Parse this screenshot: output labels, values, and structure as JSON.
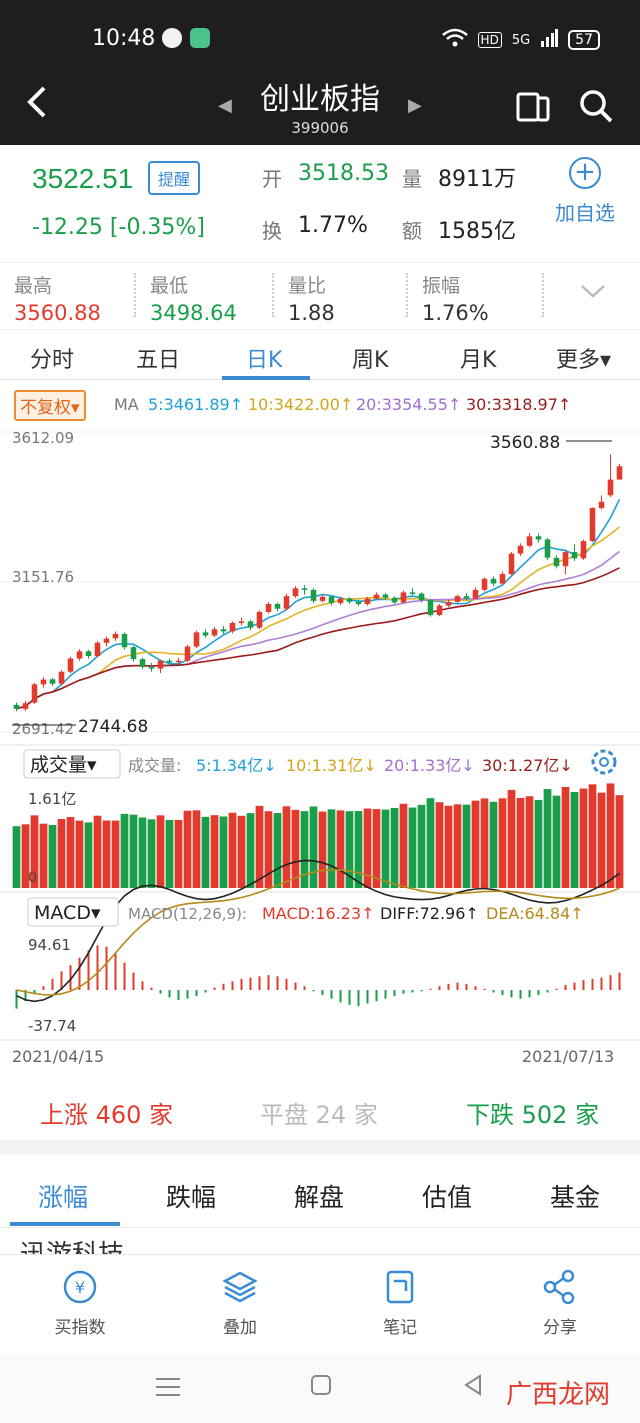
{
  "status": {
    "time": "10:48",
    "battery": "57",
    "signal": "5G",
    "hd": "HD"
  },
  "header": {
    "title": "创业板指",
    "code": "399006"
  },
  "quote": {
    "price": "3522.51",
    "remind_label": "提醒",
    "change": "-12.25",
    "change_pct": "[-0.35%]",
    "open_label": "开",
    "open": "3518.53",
    "volume_label": "量",
    "volume": "8911万",
    "turnover_label": "换",
    "turnover": "1.77%",
    "amount_label": "额",
    "amount": "1585亿",
    "add_label": "加自选"
  },
  "stats": [
    {
      "label": "最高",
      "value": "3560.88"
    },
    {
      "label": "最低",
      "value": "3498.64"
    },
    {
      "label": "量比",
      "value": "1.88"
    },
    {
      "label": "振幅",
      "value": "1.76%"
    }
  ],
  "tabs": [
    "分时",
    "五日",
    "日K",
    "周K",
    "月K",
    "更多▾"
  ],
  "ma_bar": {
    "fq_label": "不复权▾",
    "prefix": "MA",
    "ma5": "5:3461.89↑",
    "ma10": "10:3422.00↑",
    "ma20": "20:3354.55↑",
    "ma30": "30:3318.97↑"
  },
  "vol_bar": {
    "label": "成交量▾",
    "prefix": "成交量:",
    "v5": "5:1.34亿↓",
    "v10": "10:1.31亿↓",
    "v20": "20:1.33亿↓",
    "v30": "30:1.27亿↓"
  },
  "macd_bar": {
    "label": "MACD▾",
    "params": "MACD(12,26,9):",
    "macd": "MACD:16.23↑",
    "diff": "DIFF:72.96↑",
    "dea": "DEA:64.84↑"
  },
  "colors": {
    "up": "#e23b2e",
    "down": "#1a9e4a",
    "accent": "#3a8bd1",
    "ma5": "#1ea1d6",
    "ma10": "#e6b422",
    "ma20": "#b07fd6",
    "ma30": "#9b1b1b"
  },
  "chart_data": {
    "type": "candlestick",
    "price_axis": {
      "top_label": "3612.09",
      "mid_label": "3151.76",
      "bottom_label": "2691.42",
      "ylim": [
        2691.42,
        3612.09
      ]
    },
    "max_marker": "3560.88",
    "min_marker": "2744.68",
    "vol_axis": {
      "top_label": "1.61亿",
      "bottom_label": "0"
    },
    "macd_axis": {
      "top_label": "94.61",
      "bottom_label": "-37.74"
    },
    "x_start": "2021/04/15",
    "x_end": "2021/07/13",
    "candles": [
      [
        2765,
        2752,
        2772,
        2744.68
      ],
      [
        2752,
        2770,
        2778,
        2745
      ],
      [
        2772,
        2830,
        2835,
        2768
      ],
      [
        2830,
        2845,
        2852,
        2820
      ],
      [
        2846,
        2832,
        2850,
        2825
      ],
      [
        2832,
        2870,
        2875,
        2828
      ],
      [
        2870,
        2912,
        2918,
        2865
      ],
      [
        2912,
        2935,
        2942,
        2905
      ],
      [
        2935,
        2920,
        2940,
        2912
      ],
      [
        2920,
        2962,
        2968,
        2915
      ],
      [
        2962,
        2975,
        2982,
        2950
      ],
      [
        2976,
        2990,
        2998,
        2968
      ],
      [
        2990,
        2948,
        2995,
        2940
      ],
      [
        2948,
        2910,
        2952,
        2902
      ],
      [
        2910,
        2885,
        2915,
        2878
      ],
      [
        2885,
        2880,
        2898,
        2870
      ],
      [
        2880,
        2905,
        2908,
        2866
      ],
      [
        2905,
        2900,
        2912,
        2890
      ],
      [
        2900,
        2905,
        2915,
        2895
      ],
      [
        2905,
        2950,
        2955,
        2900
      ],
      [
        2950,
        2995,
        3000,
        2945
      ],
      [
        2995,
        2985,
        3005,
        2978
      ],
      [
        2985,
        3005,
        3012,
        2980
      ],
      [
        3005,
        2998,
        3015,
        2990
      ],
      [
        2998,
        3025,
        3030,
        2992
      ],
      [
        3025,
        3030,
        3042,
        3018
      ],
      [
        3030,
        3010,
        3035,
        3002
      ],
      [
        3010,
        3060,
        3065,
        3005
      ],
      [
        3060,
        3085,
        3092,
        3055
      ],
      [
        3085,
        3070,
        3090,
        3062
      ],
      [
        3070,
        3110,
        3118,
        3065
      ],
      [
        3110,
        3135,
        3142,
        3105
      ],
      [
        3135,
        3130,
        3145,
        3115
      ],
      [
        3130,
        3095,
        3135,
        3088
      ],
      [
        3095,
        3108,
        3115,
        3090
      ],
      [
        3108,
        3088,
        3112,
        3080
      ],
      [
        3088,
        3102,
        3108,
        3082
      ],
      [
        3102,
        3092,
        3106,
        3085
      ],
      [
        3092,
        3085,
        3098,
        3078
      ],
      [
        3085,
        3102,
        3108,
        3080
      ],
      [
        3102,
        3115,
        3122,
        3098
      ],
      [
        3115,
        3105,
        3120,
        3100
      ],
      [
        3105,
        3090,
        3110,
        3085
      ],
      [
        3090,
        3122,
        3128,
        3088
      ],
      [
        3122,
        3118,
        3135,
        3112
      ],
      [
        3118,
        3098,
        3122,
        3090
      ],
      [
        3098,
        3050,
        3102,
        3045
      ],
      [
        3050,
        3080,
        3085,
        3046
      ],
      [
        3080,
        3092,
        3098,
        3075
      ],
      [
        3092,
        3110,
        3115,
        3088
      ],
      [
        3110,
        3102,
        3120,
        3096
      ],
      [
        3102,
        3130,
        3138,
        3100
      ],
      [
        3130,
        3165,
        3170,
        3125
      ],
      [
        3165,
        3150,
        3172,
        3142
      ],
      [
        3150,
        3180,
        3188,
        3146
      ],
      [
        3180,
        3245,
        3250,
        3176
      ],
      [
        3245,
        3270,
        3278,
        3238
      ],
      [
        3270,
        3300,
        3310,
        3265
      ],
      [
        3300,
        3290,
        3308,
        3280
      ],
      [
        3290,
        3232,
        3295,
        3225
      ],
      [
        3232,
        3205,
        3240,
        3198
      ],
      [
        3205,
        3250,
        3255,
        3180
      ],
      [
        3250,
        3230,
        3275,
        3222
      ],
      [
        3230,
        3285,
        3290,
        3225
      ],
      [
        3285,
        3390,
        3392,
        3282
      ],
      [
        3390,
        3410,
        3430,
        3385
      ],
      [
        3430,
        3480,
        3560.88,
        3425
      ],
      [
        3480,
        3522.51,
        3530,
        3498.64
      ]
    ],
    "macd_hist": [
      -30,
      -18,
      -6,
      6,
      18,
      30,
      40,
      52,
      64,
      72,
      70,
      60,
      44,
      28,
      14,
      4,
      -6,
      -12,
      -16,
      -14,
      -10,
      -4,
      4,
      10,
      14,
      18,
      20,
      22,
      24,
      22,
      18,
      12,
      6,
      -2,
      -8,
      -14,
      -20,
      -24,
      -26,
      -22,
      -18,
      -14,
      -10,
      -6,
      -4,
      -2,
      2,
      6,
      10,
      12,
      10,
      6,
      2,
      -4,
      -8,
      -12,
      -14,
      -12,
      -8,
      -4,
      2,
      8,
      12,
      16,
      18,
      20,
      24,
      28
    ]
  },
  "breadth": {
    "up_label": "上涨",
    "up": "460",
    "up_unit": "家",
    "flat_label": "平盘",
    "flat": "24",
    "flat_unit": "家",
    "down_label": "下跌",
    "down": "502",
    "down_unit": "家"
  },
  "list_tabs": [
    "涨幅",
    "跌幅",
    "解盘",
    "估值",
    "基金"
  ],
  "list_peek": "迅游科技",
  "bottom_nav": [
    {
      "label": "买指数",
      "icon": "yuan-icon"
    },
    {
      "label": "叠加",
      "icon": "layers-icon"
    },
    {
      "label": "笔记",
      "icon": "note-icon"
    },
    {
      "label": "分享",
      "icon": "share-icon"
    }
  ],
  "watermark": "广西龙网"
}
